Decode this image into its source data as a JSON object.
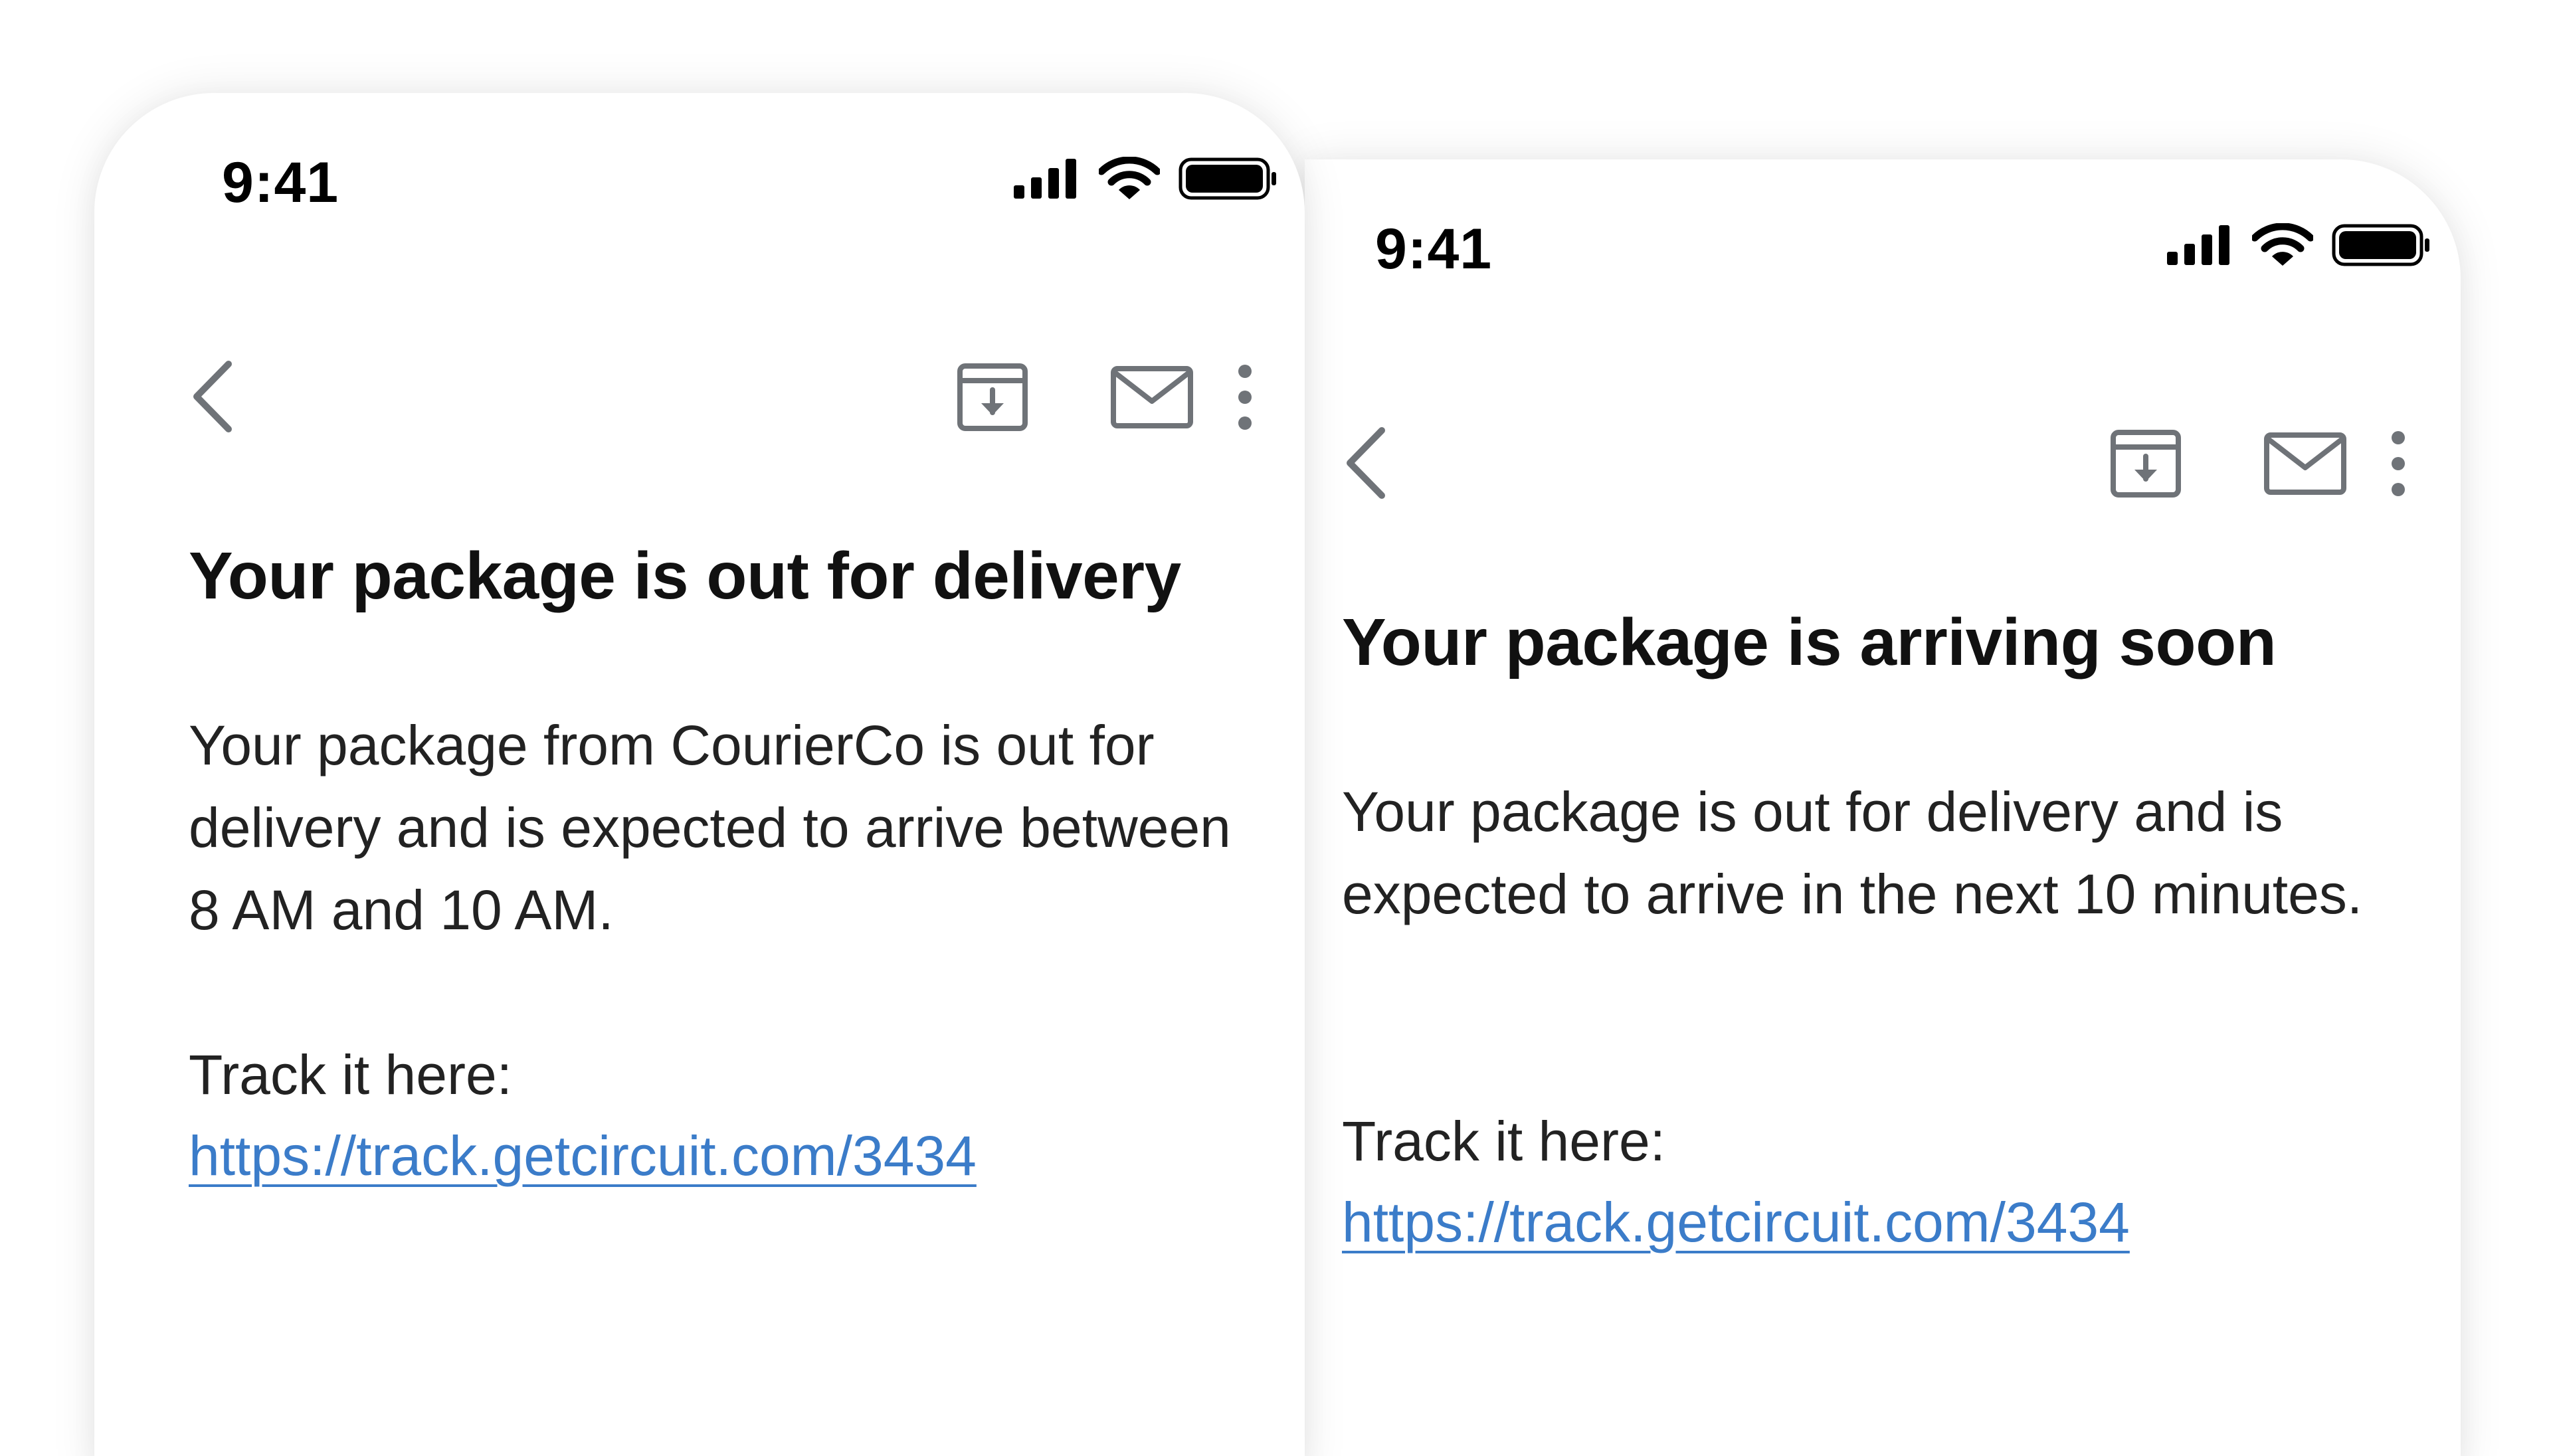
{
  "screens": [
    {
      "status": {
        "time": "9:41"
      },
      "toolbar": {
        "back_icon": "chevron-left-icon",
        "archive_icon": "archive-download-icon",
        "mail_icon": "envelope-icon",
        "more_icon": "more-vertical-icon"
      },
      "email": {
        "title": "Your package is out for delivery",
        "body": "Your package from CourierCo is out for delivery and is expected to arrive between 8 AM and 10 AM.",
        "track_label": "Track it here:",
        "track_link": "https://track.getcircuit.com/3434"
      }
    },
    {
      "status": {
        "time": "9:41"
      },
      "toolbar": {
        "back_icon": "chevron-left-icon",
        "archive_icon": "archive-download-icon",
        "mail_icon": "envelope-icon",
        "more_icon": "more-vertical-icon"
      },
      "email": {
        "title": "Your package is arriving soon",
        "body": "Your package is out for delivery and is expected to arrive in the next 10 minutes.",
        "track_label": "Track it here:",
        "track_link": "https://track.getcircuit.com/3434"
      }
    }
  ],
  "colors": {
    "link": "#3b7cc9",
    "icon": "#6f7378",
    "text": "#222222"
  }
}
